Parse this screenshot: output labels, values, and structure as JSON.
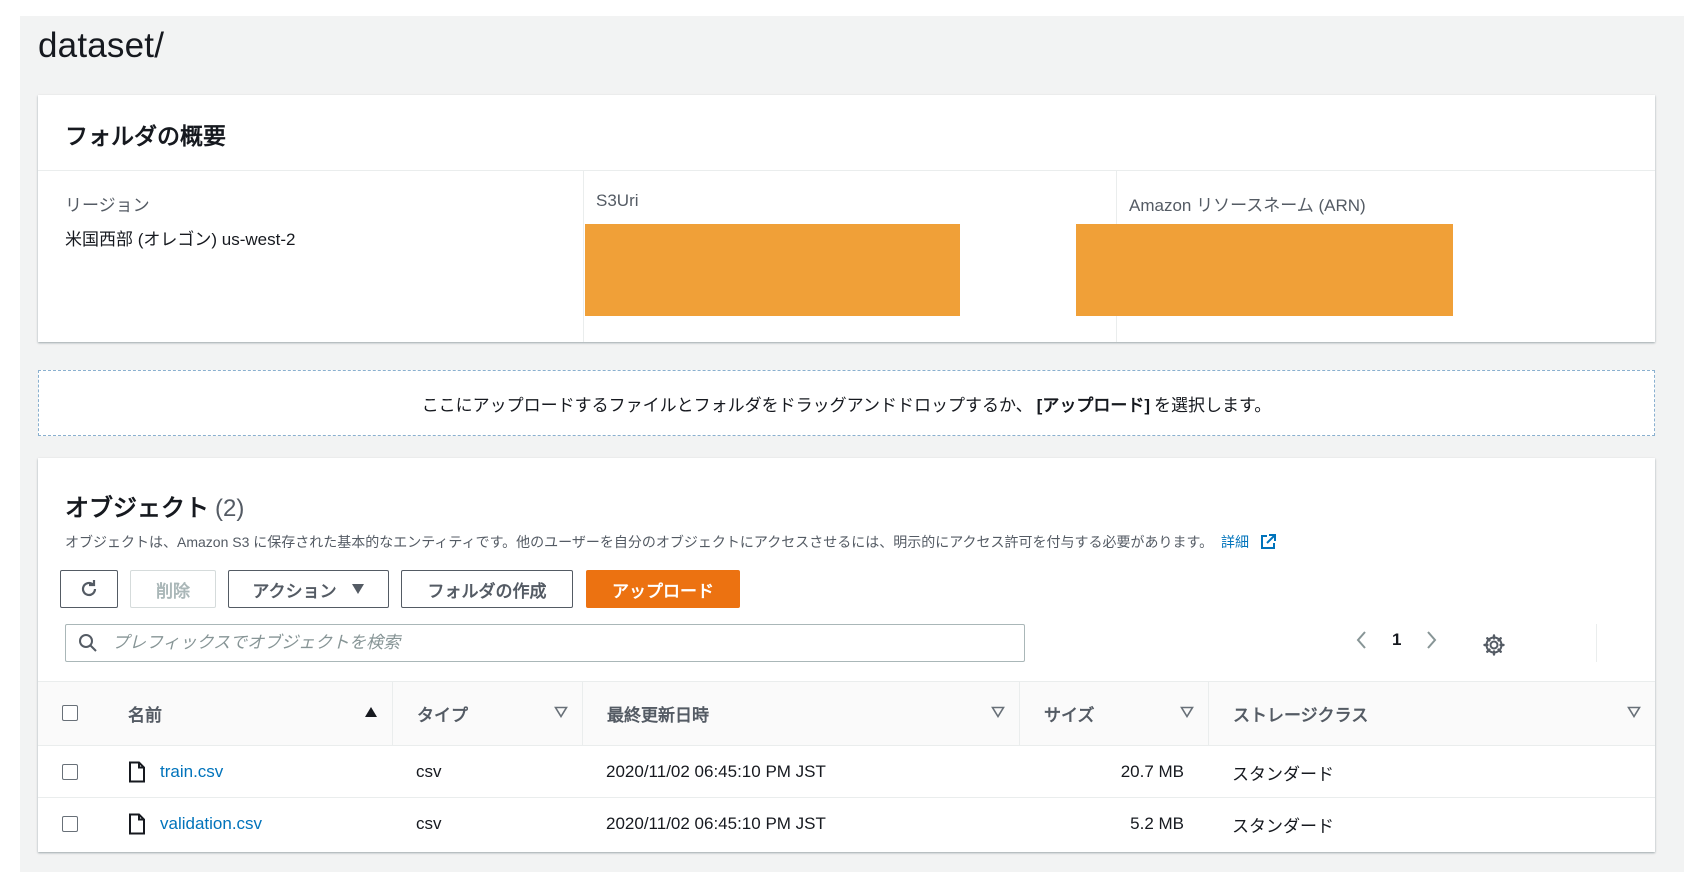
{
  "page": {
    "title": "dataset/"
  },
  "overview": {
    "header": "フォルダの概要",
    "region_label": "リージョン",
    "region_value": "米国西部 (オレゴン) us-west-2",
    "s3uri_label": "S3Uri",
    "arn_label": "Amazon リソースネーム (ARN)"
  },
  "dropzone": {
    "text_before": "ここにアップロードするファイルとフォルダをドラッグアンドドロップするか、",
    "text_bold": "[アップロード]",
    "text_after": "を選択します。"
  },
  "objects": {
    "title": "オブジェクト",
    "count": "(2)",
    "description": "オブジェクトは、Amazon S3 に保存された基本的なエンティティです。他のユーザーを自分のオブジェクトにアクセスさせるには、明示的にアクセス許可を付与する必要があります。",
    "details_link": "詳細",
    "buttons": {
      "delete": "削除",
      "actions": "アクション",
      "create_folder": "フォルダの作成",
      "upload": "アップロード"
    },
    "search_placeholder": "プレフィックスでオブジェクトを検索",
    "pagination": {
      "current_page": "1"
    },
    "columns": [
      "名前",
      "タイプ",
      "最終更新日時",
      "サイズ",
      "ストレージクラス"
    ],
    "rows": [
      {
        "name": "train.csv",
        "type": "csv",
        "modified": "2020/11/02 06:45:10 PM JST",
        "size": "20.7 MB",
        "storage_class": "スタンダード"
      },
      {
        "name": "validation.csv",
        "type": "csv",
        "modified": "2020/11/02 06:45:10 PM JST",
        "size": "5.2 MB",
        "storage_class": "スタンダード"
      }
    ]
  },
  "colors": {
    "primary_button": "#ec7211",
    "link": "#0073bb",
    "redaction": "#f0a038",
    "background": "#f2f3f3"
  },
  "icons": [
    "refresh-icon",
    "caret-down-icon",
    "search-icon",
    "chevron-left-icon",
    "chevron-right-icon",
    "gear-icon",
    "external-link-icon",
    "sort-ascending-icon",
    "sort-descending-icon",
    "file-icon"
  ]
}
